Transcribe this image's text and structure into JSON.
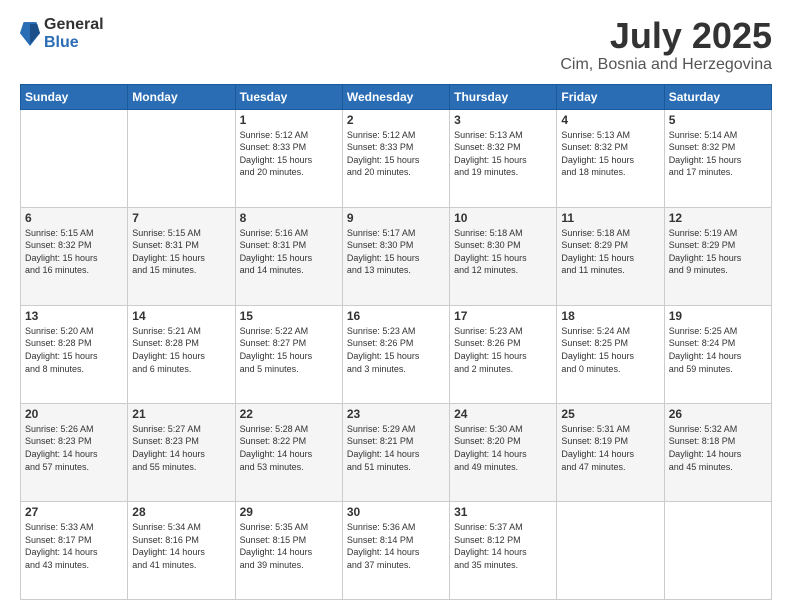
{
  "logo": {
    "general": "General",
    "blue": "Blue"
  },
  "header": {
    "month": "July 2025",
    "location": "Cim, Bosnia and Herzegovina"
  },
  "weekdays": [
    "Sunday",
    "Monday",
    "Tuesday",
    "Wednesday",
    "Thursday",
    "Friday",
    "Saturday"
  ],
  "weeks": [
    [
      {
        "day": "",
        "info": ""
      },
      {
        "day": "",
        "info": ""
      },
      {
        "day": "1",
        "info": "Sunrise: 5:12 AM\nSunset: 8:33 PM\nDaylight: 15 hours\nand 20 minutes."
      },
      {
        "day": "2",
        "info": "Sunrise: 5:12 AM\nSunset: 8:33 PM\nDaylight: 15 hours\nand 20 minutes."
      },
      {
        "day": "3",
        "info": "Sunrise: 5:13 AM\nSunset: 8:32 PM\nDaylight: 15 hours\nand 19 minutes."
      },
      {
        "day": "4",
        "info": "Sunrise: 5:13 AM\nSunset: 8:32 PM\nDaylight: 15 hours\nand 18 minutes."
      },
      {
        "day": "5",
        "info": "Sunrise: 5:14 AM\nSunset: 8:32 PM\nDaylight: 15 hours\nand 17 minutes."
      }
    ],
    [
      {
        "day": "6",
        "info": "Sunrise: 5:15 AM\nSunset: 8:32 PM\nDaylight: 15 hours\nand 16 minutes."
      },
      {
        "day": "7",
        "info": "Sunrise: 5:15 AM\nSunset: 8:31 PM\nDaylight: 15 hours\nand 15 minutes."
      },
      {
        "day": "8",
        "info": "Sunrise: 5:16 AM\nSunset: 8:31 PM\nDaylight: 15 hours\nand 14 minutes."
      },
      {
        "day": "9",
        "info": "Sunrise: 5:17 AM\nSunset: 8:30 PM\nDaylight: 15 hours\nand 13 minutes."
      },
      {
        "day": "10",
        "info": "Sunrise: 5:18 AM\nSunset: 8:30 PM\nDaylight: 15 hours\nand 12 minutes."
      },
      {
        "day": "11",
        "info": "Sunrise: 5:18 AM\nSunset: 8:29 PM\nDaylight: 15 hours\nand 11 minutes."
      },
      {
        "day": "12",
        "info": "Sunrise: 5:19 AM\nSunset: 8:29 PM\nDaylight: 15 hours\nand 9 minutes."
      }
    ],
    [
      {
        "day": "13",
        "info": "Sunrise: 5:20 AM\nSunset: 8:28 PM\nDaylight: 15 hours\nand 8 minutes."
      },
      {
        "day": "14",
        "info": "Sunrise: 5:21 AM\nSunset: 8:28 PM\nDaylight: 15 hours\nand 6 minutes."
      },
      {
        "day": "15",
        "info": "Sunrise: 5:22 AM\nSunset: 8:27 PM\nDaylight: 15 hours\nand 5 minutes."
      },
      {
        "day": "16",
        "info": "Sunrise: 5:23 AM\nSunset: 8:26 PM\nDaylight: 15 hours\nand 3 minutes."
      },
      {
        "day": "17",
        "info": "Sunrise: 5:23 AM\nSunset: 8:26 PM\nDaylight: 15 hours\nand 2 minutes."
      },
      {
        "day": "18",
        "info": "Sunrise: 5:24 AM\nSunset: 8:25 PM\nDaylight: 15 hours\nand 0 minutes."
      },
      {
        "day": "19",
        "info": "Sunrise: 5:25 AM\nSunset: 8:24 PM\nDaylight: 14 hours\nand 59 minutes."
      }
    ],
    [
      {
        "day": "20",
        "info": "Sunrise: 5:26 AM\nSunset: 8:23 PM\nDaylight: 14 hours\nand 57 minutes."
      },
      {
        "day": "21",
        "info": "Sunrise: 5:27 AM\nSunset: 8:23 PM\nDaylight: 14 hours\nand 55 minutes."
      },
      {
        "day": "22",
        "info": "Sunrise: 5:28 AM\nSunset: 8:22 PM\nDaylight: 14 hours\nand 53 minutes."
      },
      {
        "day": "23",
        "info": "Sunrise: 5:29 AM\nSunset: 8:21 PM\nDaylight: 14 hours\nand 51 minutes."
      },
      {
        "day": "24",
        "info": "Sunrise: 5:30 AM\nSunset: 8:20 PM\nDaylight: 14 hours\nand 49 minutes."
      },
      {
        "day": "25",
        "info": "Sunrise: 5:31 AM\nSunset: 8:19 PM\nDaylight: 14 hours\nand 47 minutes."
      },
      {
        "day": "26",
        "info": "Sunrise: 5:32 AM\nSunset: 8:18 PM\nDaylight: 14 hours\nand 45 minutes."
      }
    ],
    [
      {
        "day": "27",
        "info": "Sunrise: 5:33 AM\nSunset: 8:17 PM\nDaylight: 14 hours\nand 43 minutes."
      },
      {
        "day": "28",
        "info": "Sunrise: 5:34 AM\nSunset: 8:16 PM\nDaylight: 14 hours\nand 41 minutes."
      },
      {
        "day": "29",
        "info": "Sunrise: 5:35 AM\nSunset: 8:15 PM\nDaylight: 14 hours\nand 39 minutes."
      },
      {
        "day": "30",
        "info": "Sunrise: 5:36 AM\nSunset: 8:14 PM\nDaylight: 14 hours\nand 37 minutes."
      },
      {
        "day": "31",
        "info": "Sunrise: 5:37 AM\nSunset: 8:12 PM\nDaylight: 14 hours\nand 35 minutes."
      },
      {
        "day": "",
        "info": ""
      },
      {
        "day": "",
        "info": ""
      }
    ]
  ]
}
